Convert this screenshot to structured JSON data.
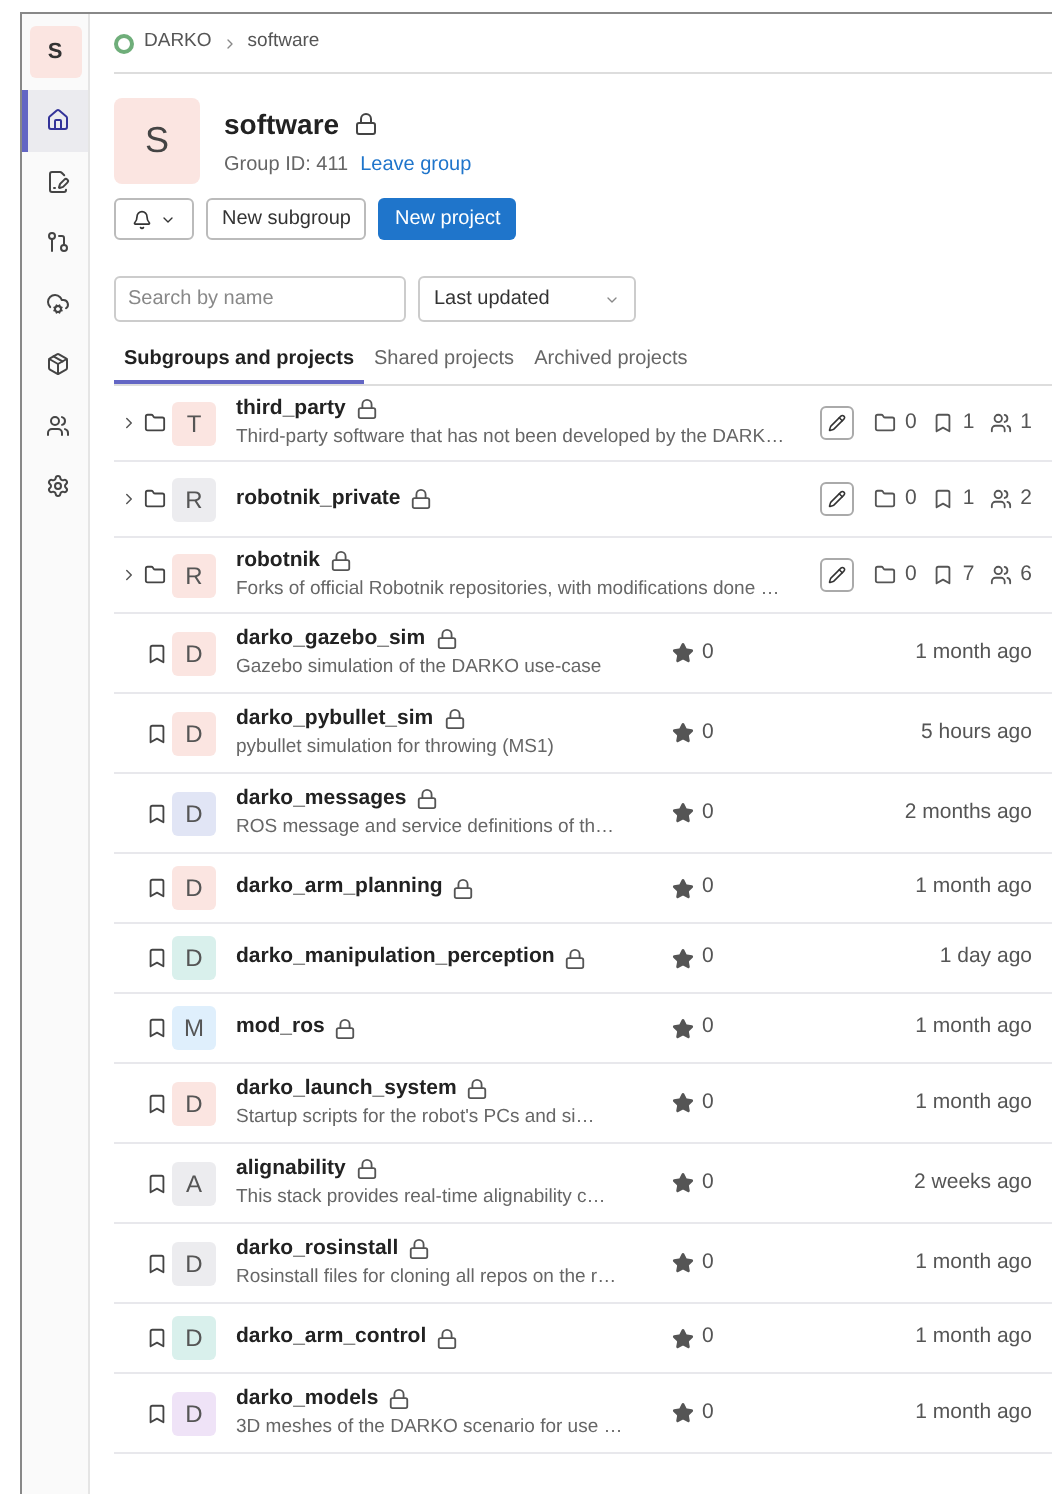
{
  "sidebar": {
    "avatar": "S",
    "items": [
      {
        "selected": true
      },
      {
        "selected": false
      },
      {
        "selected": false
      },
      {
        "selected": false
      },
      {
        "selected": false
      },
      {
        "selected": false
      },
      {
        "selected": false
      }
    ]
  },
  "breadcrumb": [
    "DARKO",
    "software"
  ],
  "group": {
    "avatar": "S",
    "name": "software",
    "id_label": "Group ID: 411",
    "leave_link": "Leave group"
  },
  "buttons": {
    "new_subgroup": "New subgroup",
    "new_project": "New project"
  },
  "search": {
    "placeholder": "Search by name"
  },
  "sort": {
    "value": "Last updated"
  },
  "tabs": [
    {
      "label": "Subgroups and projects",
      "selected": true
    },
    {
      "label": "Shared projects",
      "selected": false
    },
    {
      "label": "Archived projects",
      "selected": false
    }
  ],
  "rows": [
    {
      "kind": "group",
      "avatar": "T",
      "color": "#fbe5e1",
      "name": "third_party",
      "description": "Third-party software that has not been developed by the DARK…",
      "subgroups": "0",
      "projects": "1",
      "members": "1"
    },
    {
      "kind": "group",
      "avatar": "R",
      "color": "#ececef",
      "name": "robotnik_private",
      "subgroups": "0",
      "projects": "1",
      "members": "2"
    },
    {
      "kind": "group",
      "avatar": "R",
      "color": "#fbe5e1",
      "name": "robotnik",
      "description": "Forks of official Robotnik repositories, with modifications done …",
      "subgroups": "0",
      "projects": "7",
      "members": "6"
    },
    {
      "kind": "project",
      "avatar": "D",
      "color": "#fbe5e1",
      "name": "darko_gazebo_sim",
      "description": "Gazebo simulation of the DARKO use-case",
      "stars": "0",
      "updated": "1 month ago"
    },
    {
      "kind": "project",
      "avatar": "D",
      "color": "#fbe5e1",
      "name": "darko_pybullet_sim",
      "description": "pybullet simulation for throwing (MS1)",
      "stars": "0",
      "updated": "5 hours ago"
    },
    {
      "kind": "project",
      "avatar": "D",
      "color": "#e1e5f5",
      "name": "darko_messages",
      "description": "ROS message and service definitions of th…",
      "stars": "0",
      "updated": "2 months ago"
    },
    {
      "kind": "project",
      "avatar": "D",
      "color": "#fbe5e1",
      "name": "darko_arm_planning",
      "stars": "0",
      "updated": "1 month ago"
    },
    {
      "kind": "project",
      "avatar": "D",
      "color": "#d9f0ec",
      "name": "darko_manipulation_perception",
      "stars": "0",
      "updated": "1 day ago"
    },
    {
      "kind": "project",
      "avatar": "M",
      "color": "#dfeffc",
      "name": "mod_ros",
      "stars": "0",
      "updated": "1 month ago"
    },
    {
      "kind": "project",
      "avatar": "D",
      "color": "#fbe5e1",
      "name": "darko_launch_system",
      "description": "Startup scripts for the robot's PCs and si…",
      "stars": "0",
      "updated": "1 month ago"
    },
    {
      "kind": "project",
      "avatar": "A",
      "color": "#ececef",
      "name": "alignability",
      "description": "This stack provides real-time alignability c…",
      "stars": "0",
      "updated": "2 weeks ago"
    },
    {
      "kind": "project",
      "avatar": "D",
      "color": "#ececef",
      "name": "darko_rosinstall",
      "description": "Rosinstall files for cloning all repos on the r…",
      "stars": "0",
      "updated": "1 month ago"
    },
    {
      "kind": "project",
      "avatar": "D",
      "color": "#d9f0ec",
      "name": "darko_arm_control",
      "stars": "0",
      "updated": "1 month ago"
    },
    {
      "kind": "project",
      "avatar": "D",
      "color": "#efe3f7",
      "name": "darko_models",
      "description": "3D meshes of the DARKO scenario for use …",
      "stars": "0",
      "updated": "1 month ago"
    }
  ]
}
